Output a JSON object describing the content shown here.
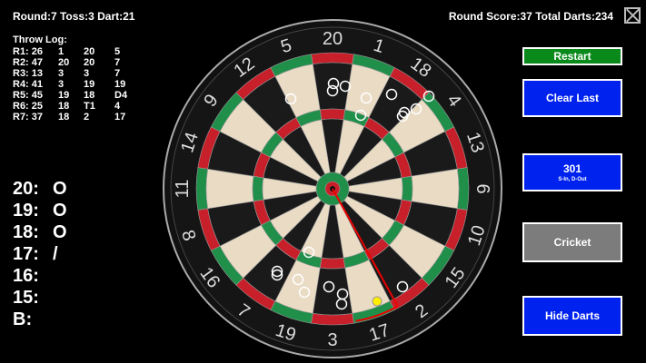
{
  "header": {
    "round_info": "Round:7 Toss:3 Dart:21",
    "score_info": "Round Score:37  Total Darts:234"
  },
  "throw_log": {
    "title": "Throw Log:",
    "rows": [
      [
        "R1: 26",
        "1",
        "20",
        "5",
        ""
      ],
      [
        "R2: 47",
        "20",
        "20",
        "7",
        ""
      ],
      [
        "R3: 13",
        "3",
        "3",
        "7",
        ""
      ],
      [
        "R4: 41",
        "3",
        "19",
        "19",
        ""
      ],
      [
        "R5: 45",
        "19",
        "18",
        "D4",
        ""
      ],
      [
        "R6: 25",
        "18",
        "T1",
        "4",
        ""
      ],
      [
        "R7: 37",
        "18",
        "2",
        "17",
        ""
      ]
    ]
  },
  "cricket_marks": [
    {
      "label": "20:",
      "mark": "O"
    },
    {
      "label": "19:",
      "mark": "O"
    },
    {
      "label": "18:",
      "mark": "O"
    },
    {
      "label": "17:",
      "mark": "/"
    },
    {
      "label": "16:",
      "mark": ""
    },
    {
      "label": "15:",
      "mark": ""
    },
    {
      "label": "B:",
      "mark": ""
    }
  ],
  "buttons": {
    "restart": "Restart",
    "clear_last": "Clear Last",
    "mode_301": "301",
    "mode_301_sub": "S-In, D-Out",
    "cricket": "Cricket",
    "hide_darts": "Hide Darts"
  },
  "board": {
    "numbers": [
      "20",
      "1",
      "18",
      "4",
      "13",
      "6",
      "10",
      "15",
      "2",
      "17",
      "3",
      "19",
      "7",
      "16",
      "8",
      "11",
      "14",
      "9",
      "12",
      "5"
    ],
    "colors": {
      "black": "#1a1a1a",
      "cream": "#eadbc4",
      "red": "#c8202a",
      "green": "#1f8f4a",
      "wire": "#9a9a9a"
    }
  },
  "icons": {
    "close": "close-x-icon"
  }
}
